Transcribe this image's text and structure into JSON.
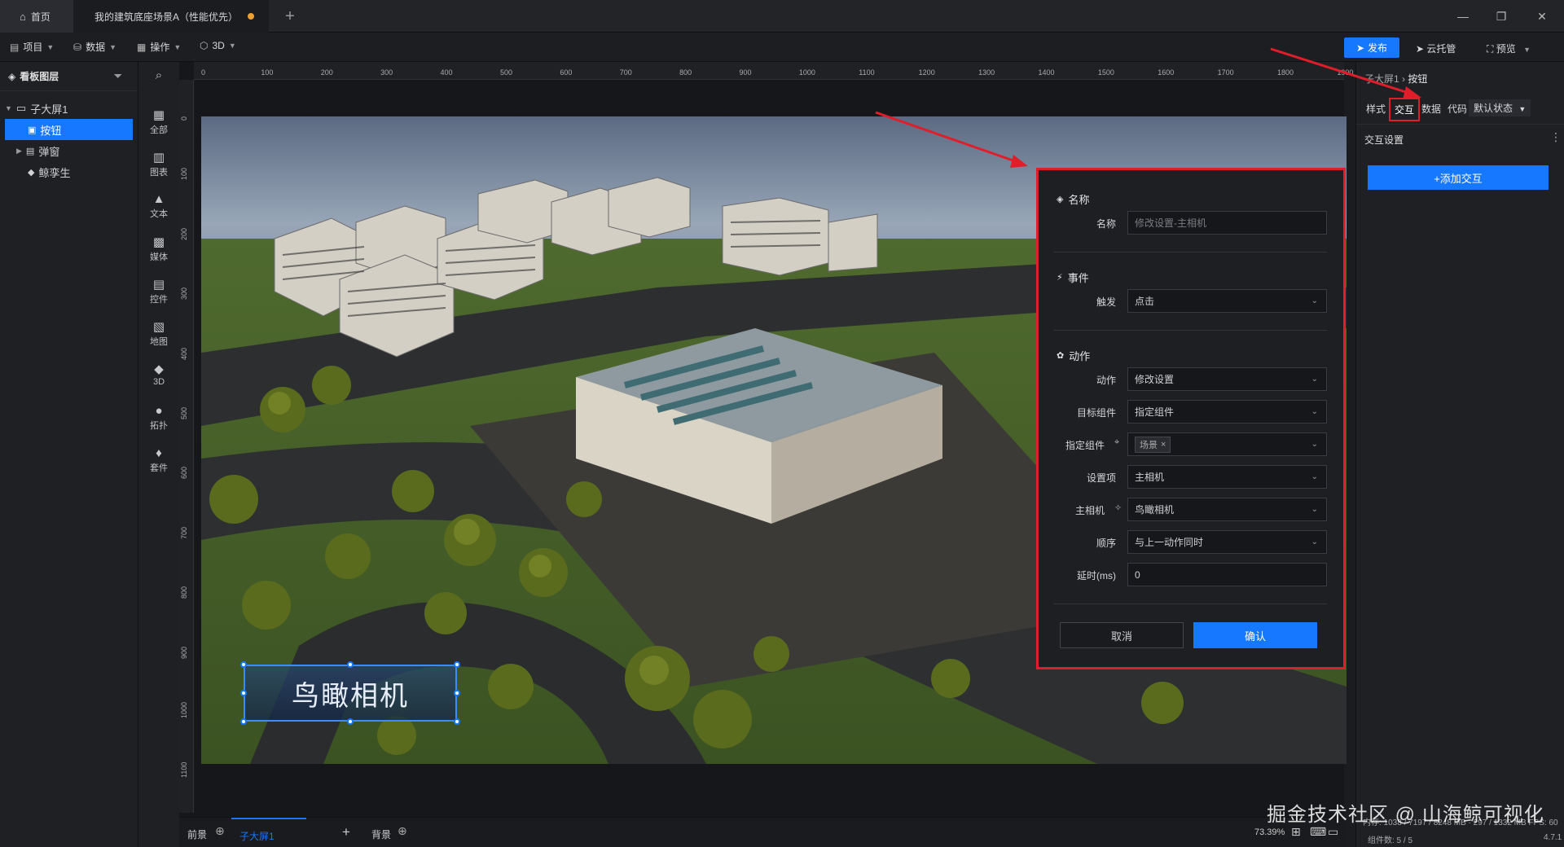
{
  "titlebar": {
    "home_tab": "首页",
    "doc_tab": "我的建筑底座场景A（性能优先）"
  },
  "menubar": {
    "project": "项目",
    "data": "数据",
    "operate": "操作",
    "threed": "3D",
    "publish": "发布",
    "cloud": "云托管",
    "preview": "预览"
  },
  "layers": {
    "title": "看板图层",
    "items": [
      {
        "label": "子大屏1"
      },
      {
        "label": "按钮"
      },
      {
        "label": "弹窗"
      },
      {
        "label": "鲸孪生"
      }
    ]
  },
  "tools": [
    "全部",
    "图表",
    "文本",
    "媒体",
    "控件",
    "地图",
    "3D",
    "拓扑",
    "套件"
  ],
  "ruler": {
    "top": [
      "0",
      "100",
      "200",
      "300",
      "400",
      "500",
      "600",
      "700",
      "800",
      "900",
      "1000",
      "1100",
      "1200",
      "1300",
      "1400",
      "1500",
      "1600",
      "1700",
      "1800",
      "1900"
    ],
    "left": [
      "0",
      "100",
      "200",
      "300",
      "400",
      "500",
      "600",
      "700",
      "800",
      "900",
      "1000",
      "1100"
    ]
  },
  "scene_button": {
    "label": "鸟瞰相机"
  },
  "interaction_form": {
    "name_section": "名称",
    "name_label": "名称",
    "name_placeholder": "修改设置-主相机",
    "event_section": "事件",
    "trigger_label": "触发",
    "trigger_value": "点击",
    "action_section": "动作",
    "action_label": "动作",
    "action_value": "修改设置",
    "target_label": "目标组件",
    "target_value": "指定组件",
    "specified_label": "指定组件",
    "specified_tag": "场景",
    "setting_label": "设置项",
    "setting_value": "主相机",
    "camera_label": "主相机",
    "camera_value": "鸟瞰相机",
    "order_label": "顺序",
    "order_value": "与上一动作同时",
    "delay_label": "延时(ms)",
    "delay_value": "0",
    "cancel": "取消",
    "confirm": "确认"
  },
  "right_panel": {
    "breadcrumb_root": "子大屏1",
    "breadcrumb_leaf": "按钮",
    "tabs": [
      "样式",
      "交互",
      "数据",
      "代码"
    ],
    "state": "默认状态",
    "section_title": "交互设置",
    "add_button": "+添加交互"
  },
  "bottombar": {
    "front": "前景",
    "screen_tab": "子大屏1",
    "back": "背景",
    "zoom": "73.39%",
    "memory": "内存: 1038 / 7197 / 8248 MB · 297 / 1332 MB FPS: 60",
    "components": "组件数: 5 / 5",
    "version": "4.7.1"
  },
  "watermark": "掘金技术社区 @ 山海鲸可视化",
  "colors": {
    "accent": "#1677ff",
    "highlight": "#e01e2a",
    "modified_dot": "#f0a030"
  }
}
